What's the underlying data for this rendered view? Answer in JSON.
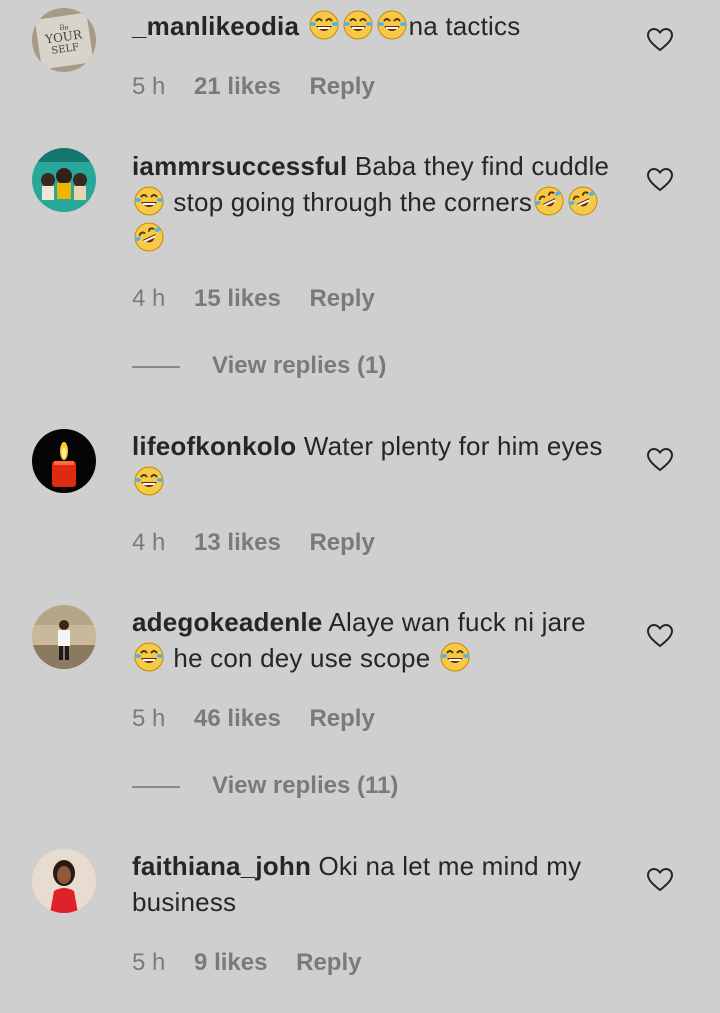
{
  "comments": [
    {
      "username": "_manlikeodia",
      "text_after_emojis": "na tactics",
      "time": "5 h",
      "likes": "21 likes",
      "reply": "Reply",
      "avatar_text": "Be YOUR SELF"
    },
    {
      "username": "iammrsuccessful",
      "text_1": "Baba they find cuddle",
      "text_2": " stop going through the corners",
      "time": "4 h",
      "likes": "15 likes",
      "reply": "Reply",
      "view_replies": "View replies (1)"
    },
    {
      "username": "lifeofkonkolo",
      "text_1": "Water plenty for him eyes",
      "time": "4 h",
      "likes": "13 likes",
      "reply": "Reply"
    },
    {
      "username": "adegokeadenle",
      "text_1": "Alaye wan fuck ni jare",
      "text_2": " he con dey use scope ",
      "time": "5 h",
      "likes": "46 likes",
      "reply": "Reply",
      "view_replies": "View replies (11)"
    },
    {
      "username": "faithiana_john",
      "text_1": "Oki na let me mind my business",
      "time": "5 h",
      "likes": "9 likes",
      "reply": "Reply"
    }
  ],
  "icons": {
    "like": "heart-outline-icon",
    "joy": "face-with-tears-of-joy-icon",
    "rofl": "rolling-on-floor-laughing-icon"
  },
  "colors": {
    "background": "#cfcfcf",
    "text": "#262626",
    "muted": "#7a7a7a"
  }
}
